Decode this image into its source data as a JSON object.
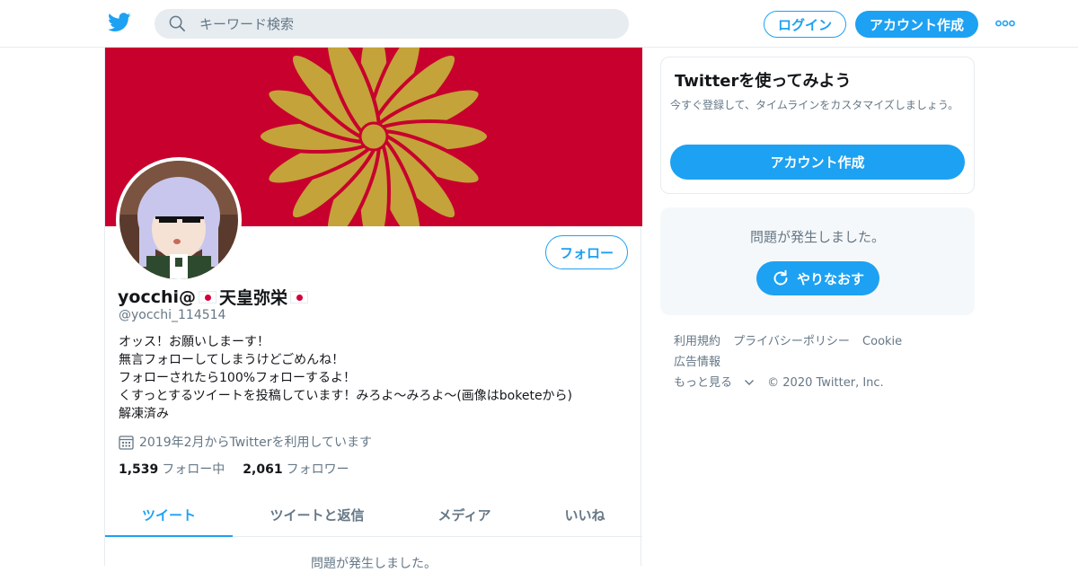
{
  "header": {
    "logo_icon": "twitter-bird-icon",
    "search_placeholder": "キーワード検索",
    "login_label": "ログイン",
    "signup_label": "アカウント作成",
    "more_icon": "more-dots-icon",
    "accent_color": "#1da1f2"
  },
  "profile": {
    "banner_icon": "imperial-chrysanthemum-seal",
    "name_prefix": "yocchi@",
    "name_main": "天皇弥栄",
    "handle": "@yocchi_114514",
    "follow_label": "フォロー",
    "bio_lines": [
      "オッス！お願いしまーす！",
      "無言フォローしてしまうけどごめんね！",
      "フォローされたら100%フォローするよ！",
      "くすっとするツイートを投稿しています！みろよ～みろよ～(画像はboketeから)",
      "解凍済み"
    ],
    "joined": "2019年2月からTwitterを利用しています",
    "following_count": "1,539",
    "following_label": "フォロー中",
    "followers_count": "2,061",
    "followers_label": "フォロワー"
  },
  "tabs": [
    "ツイート",
    "ツイートと返信",
    "メディア",
    "いいね"
  ],
  "timeline_error": "問題が発生しました。",
  "sidebar": {
    "signup_title": "Twitterを使ってみよう",
    "signup_desc": "今すぐ登録して、タイムラインをカスタマイズしましょう。",
    "signup_button": "アカウント作成",
    "error_message": "問題が発生しました。",
    "retry_label": "やりなおす",
    "footer_links": [
      "利用規約",
      "プライバシーポリシー",
      "Cookie",
      "広告情報",
      "もっと見る"
    ],
    "copyright": "© 2020 Twitter, Inc."
  }
}
